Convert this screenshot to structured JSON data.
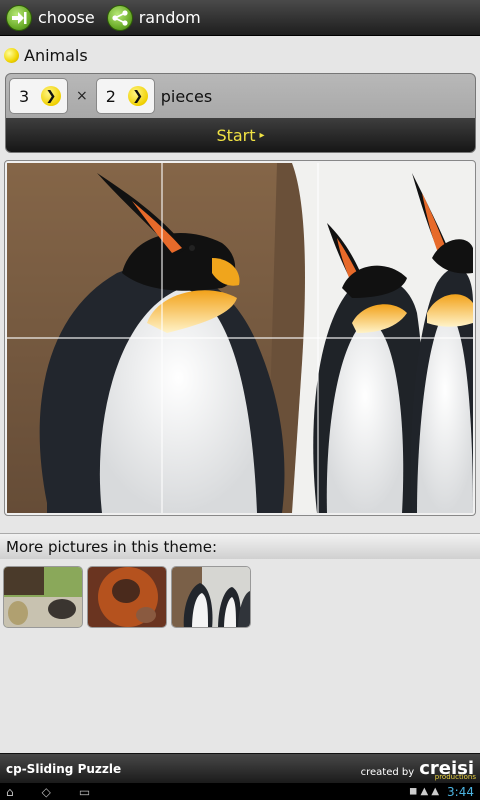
{
  "toolbar": {
    "choose_label": "choose",
    "random_label": "random",
    "choose_icon": "arrow-in-icon",
    "random_icon": "share-icon"
  },
  "theme": {
    "label": "Animals",
    "bullet_color": "#f0d400"
  },
  "config": {
    "cols": "3",
    "rows": "2",
    "times": "×",
    "pieces_label": "pieces",
    "start_label": "Start",
    "start_arrow": "▸",
    "accent": "#f1e344"
  },
  "puzzle": {
    "grid_cols": 3,
    "grid_rows": 2,
    "subject": "king penguins"
  },
  "more": {
    "header": "More pictures in this theme:",
    "thumbnails": [
      "hedgehog",
      "orangutan",
      "penguins"
    ]
  },
  "footer": {
    "app_name": "cp-Sliding Puzzle",
    "created_by": "created by",
    "logo": "creisi",
    "logo_sub": "productions"
  },
  "system": {
    "back_icon": "⌂",
    "home_icon": "◇",
    "recents_icon": "▭",
    "status": "◼ ▲ ▲",
    "clock": "3:44"
  }
}
